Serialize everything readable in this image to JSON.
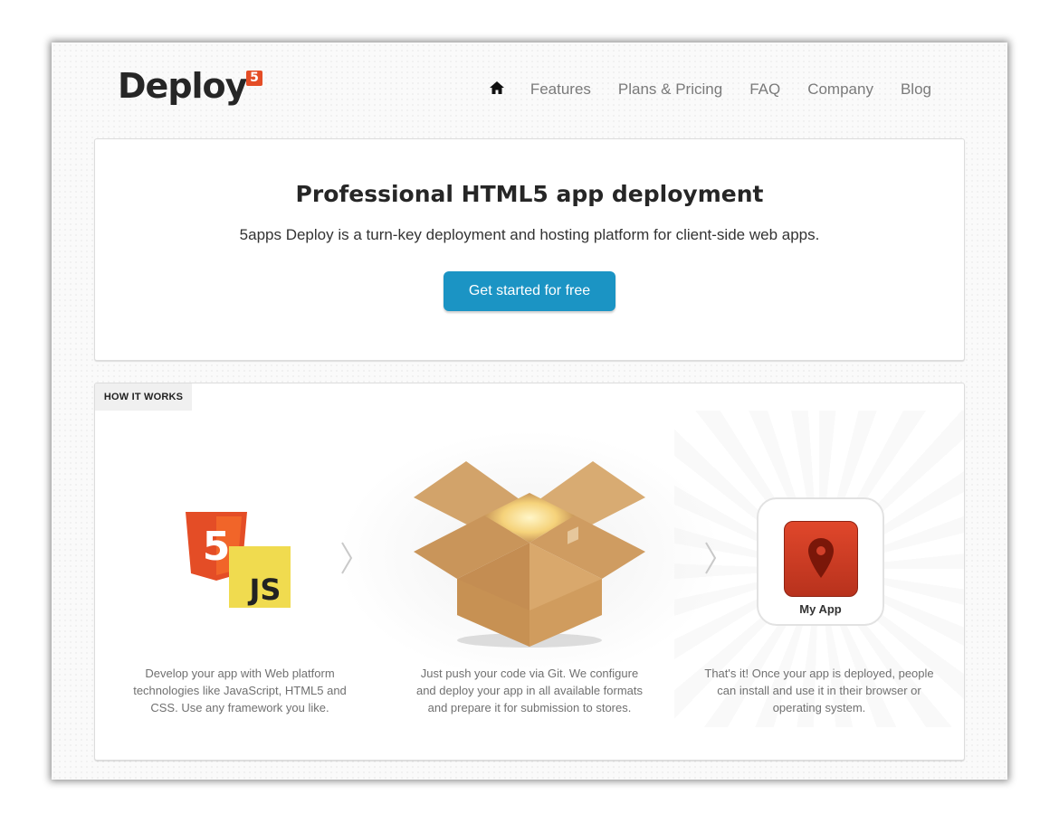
{
  "header": {
    "logo_text": "Deploy",
    "logo_badge": "5",
    "nav": {
      "home_icon": "home-icon",
      "items": [
        "Features",
        "Plans & Pricing",
        "FAQ",
        "Company",
        "Blog"
      ]
    }
  },
  "hero": {
    "title": "Professional HTML5 app deployment",
    "subtitle": "5apps Deploy is a turn-key deployment and hosting platform for client-side web apps.",
    "cta_label": "Get started for free"
  },
  "how": {
    "tab_label": "HOW IT WORKS",
    "steps": [
      {
        "icon": "html5-js-icon",
        "text": "Develop your app with Web platform technologies like JavaScript, HTML5 and CSS. Use any framework you like."
      },
      {
        "icon": "open-box-icon",
        "text": "Just push your code via Git. We configure and deploy your app in all available formats and prepare it for submission to stores."
      },
      {
        "icon": "app-tile-icon",
        "text": "That's it! Once your app is deployed, people can install and use it in their browser or operating system."
      }
    ],
    "js_text": "JS",
    "html5_text": "5",
    "app_label": "My App"
  },
  "colors": {
    "accent": "#1b94c4",
    "html5": "#e44d26",
    "js": "#f0db4f",
    "app_red": "#d1402a"
  }
}
